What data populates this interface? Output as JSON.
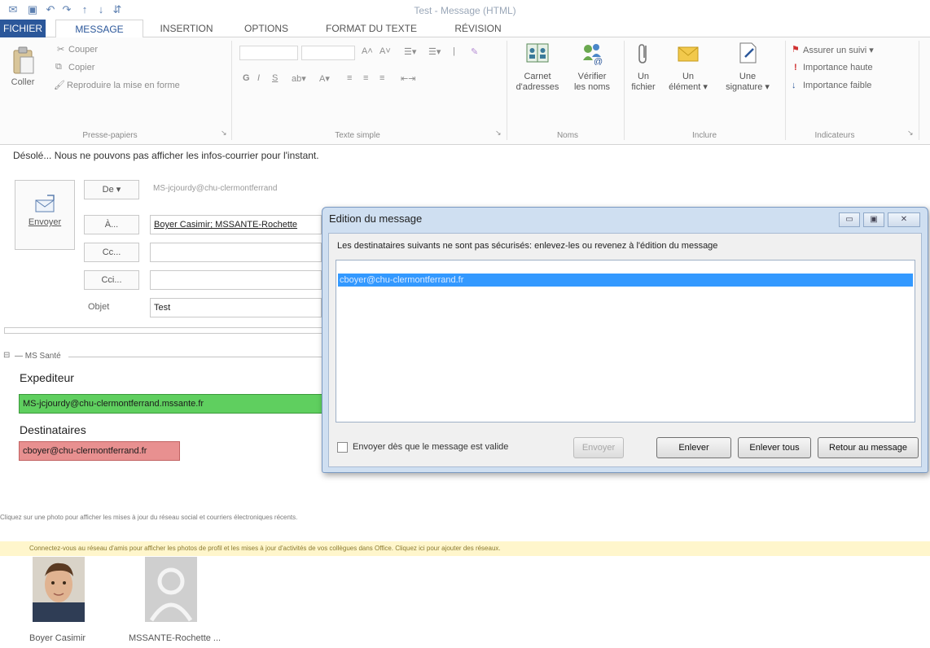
{
  "window": {
    "title": "Test - Message (HTML)"
  },
  "tabs": [
    {
      "label": "FICHIER"
    },
    {
      "label": "MESSAGE"
    },
    {
      "label": "INSERTION"
    },
    {
      "label": "OPTIONS"
    },
    {
      "label": "FORMAT DU TEXTE"
    },
    {
      "label": "RÉVISION"
    }
  ],
  "ribbon": {
    "clipboard": {
      "paste": "Coller",
      "cut": "Couper",
      "copy": "Copier",
      "format_painter": "Reproduire la mise en forme",
      "label": "Presse-papiers"
    },
    "basic_text": {
      "label": "Texte simple",
      "bold": "G",
      "italic": "I",
      "underline": "S"
    },
    "names": {
      "address_book_line1": "Carnet",
      "address_book_line2": "d'adresses",
      "check_names_line1": "Vérifier",
      "check_names_line2": "les noms",
      "label": "Noms"
    },
    "include": {
      "file_line1": "Un",
      "file_line2": "fichier",
      "item_line1": "Un",
      "item_line2": "élément ▾",
      "signature_line1": "Une",
      "signature_line2": "signature ▾",
      "label": "Inclure"
    },
    "tags": {
      "follow_up": "Assurer un suivi ▾",
      "high": "Importance haute",
      "low": "Importance faible",
      "label": "Indicateurs"
    }
  },
  "infobar": {
    "text": "Désolé... Nous ne pouvons pas afficher les infos-courrier pour l'instant."
  },
  "compose": {
    "send": "Envoyer",
    "from_btn": "De ▾",
    "from_value": "MS-jcjourdy@chu-clermontferrand",
    "to_btn": "À...",
    "to_value": "Boyer Casimir; MSSANTE-Rochette",
    "cc_btn": "Cc...",
    "bcc_btn": "Cci...",
    "subject_label": "Objet",
    "subject_value": "Test"
  },
  "mssante": {
    "section_label": "— MS Santé",
    "sender_label": "Expediteur",
    "sender_value": "MS-jcjourdy@chu-clermontferrand.mssante.fr",
    "recipients_label": "Destinataires",
    "recipient_value": "cboyer@chu-clermontferrand.fr"
  },
  "dialog": {
    "title": "Edition du message",
    "message": "Les destinataires suivants ne sont pas sécurisés: enlevez-les ou revenez à l'édition du message",
    "list_items": [
      "cboyer@chu-clermontferrand.fr"
    ],
    "checkbox_label": "Envoyer dès que le message est valide",
    "send_button": "Envoyer",
    "remove_button": "Enlever",
    "remove_all_button": "Enlever tous",
    "back_button": "Retour au message"
  },
  "footer": {
    "photo_hint": "Cliquez sur une photo pour afficher les mises à jour du réseau social et courriers électroniques récents.",
    "connect_notice": "Connectez-vous au réseau d'amis pour afficher les photos de profil et les mises à jour d'activités de vos collègues dans Office. Cliquez ici pour ajouter des réseaux.",
    "people": [
      {
        "name": "Boyer Casimir"
      },
      {
        "name": "MSSANTE-Rochette ..."
      }
    ]
  },
  "colors": {
    "accent": "#2b579a",
    "sender_ok": "#5fcf5f",
    "recipient_bad": "#e89090",
    "selection": "#3399ff",
    "notice": "#fff6cc"
  }
}
